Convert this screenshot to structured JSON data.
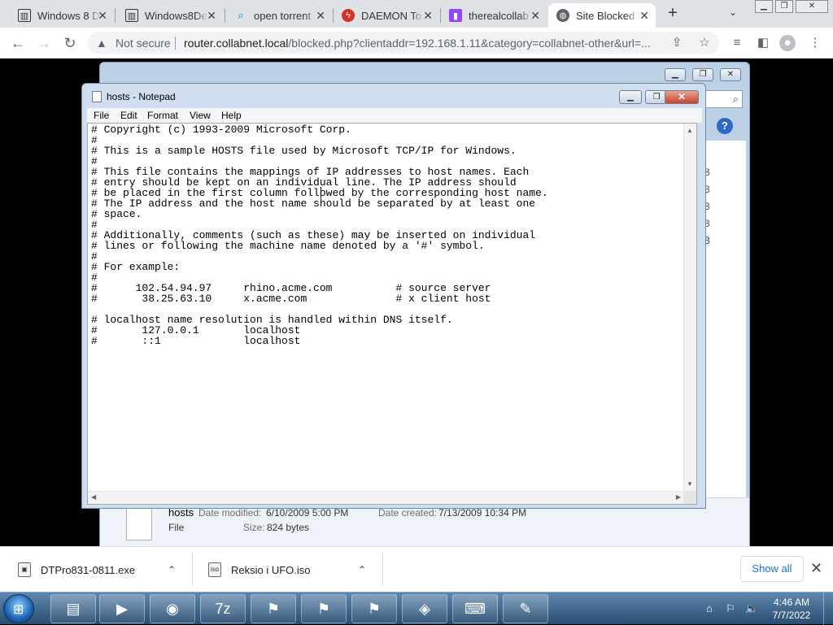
{
  "browser": {
    "tabs": [
      {
        "title": "Windows 8 D",
        "icon": "archive-icon",
        "active": false
      },
      {
        "title": "Windows8De",
        "icon": "archive-icon",
        "active": false
      },
      {
        "title": "open torrent",
        "icon": "search-icon",
        "active": false
      },
      {
        "title": "DAEMON To",
        "icon": "daemon-tools-icon",
        "active": false
      },
      {
        "title": "therealcollab",
        "icon": "twitch-icon",
        "active": false
      },
      {
        "title": "Site Blocked",
        "icon": "globe-icon",
        "active": true
      }
    ],
    "security_label": "Not secure",
    "url_host": "router.collabnet.local",
    "url_rest": "/blocked.php?clientaddr=192.168.1.11&category=collabnet-other&url=..."
  },
  "explorer": {
    "list_size_fragments": [
      "B",
      "B",
      "B",
      "B",
      "B"
    ],
    "details": {
      "name": "hosts",
      "date_modified_label": "Date modified:",
      "date_modified": "6/10/2009 5:00 PM",
      "date_created_label": "Date created:",
      "date_created": "7/13/2009 10:34 PM",
      "type": "File",
      "size_label": "Size:",
      "size": "824 bytes"
    }
  },
  "notepad": {
    "title": "hosts - Notepad",
    "menu": [
      "File",
      "Edit",
      "Format",
      "View",
      "Help"
    ],
    "content": "# Copyright (c) 1993-2009 Microsoft Corp.\n#\n# This is a sample HOSTS file used by Microsoft TCP/IP for Windows.\n#\n# This file contains the mappings of IP addresses to host names. Each\n# entry should be kept on an individual line. The IP address should\n# be placed in the first column followed by the corresponding host name.\n# The IP address and the host name should be separated by at least one\n# space.\n#\n# Additionally, comments (such as these) may be inserted on individual\n# lines or following the machine name denoted by a '#' symbol.\n#\n# For example:\n#\n#      102.54.94.97     rhino.acme.com          # source server\n#       38.25.63.10     x.acme.com              # x client host\n\n# localhost name resolution is handled within DNS itself.\n#\t127.0.0.1       localhost\n#\t::1             localhost"
  },
  "downloads": {
    "items": [
      {
        "name": "DTPro831-0811.exe"
      },
      {
        "name": "Reksio i UFO.iso"
      }
    ],
    "show_all": "Show all"
  },
  "taskbar": {
    "apps": [
      "explorer",
      "media-player",
      "chrome",
      "7zip",
      "windows-flag",
      "windows-flag",
      "windows-flag",
      "virtual-drive",
      "network-tool",
      "notepad"
    ],
    "clock_time": "4:46 AM",
    "clock_date": "7/7/2022"
  }
}
